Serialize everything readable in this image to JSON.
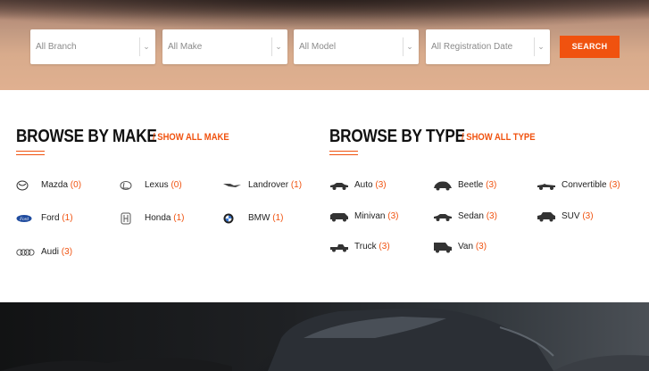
{
  "search": {
    "branch": "All Branch",
    "make": "All Make",
    "model": "All Model",
    "registration_date": "All Registration Date",
    "button": "SEARCH"
  },
  "make_section": {
    "title": "BROWSE BY MAKE",
    "show_all": "/ SHOW ALL MAKE",
    "items": [
      {
        "name": "Mazda",
        "count": "(0)",
        "icon": "mazda-logo-icon"
      },
      {
        "name": "Lexus",
        "count": "(0)",
        "icon": "lexus-logo-icon"
      },
      {
        "name": "Landrover",
        "count": "(1)",
        "icon": "landrover-logo-icon"
      },
      {
        "name": "Ford",
        "count": "(1)",
        "icon": "ford-logo-icon"
      },
      {
        "name": "Honda",
        "count": "(1)",
        "icon": "honda-logo-icon"
      },
      {
        "name": "BMW",
        "count": "(1)",
        "icon": "bmw-logo-icon"
      },
      {
        "name": "Audi",
        "count": "(3)",
        "icon": "audi-logo-icon"
      }
    ]
  },
  "type_section": {
    "title": "BROWSE BY TYPE",
    "show_all": "/ SHOW ALL TYPE",
    "items": [
      {
        "name": "Auto",
        "count": "(3)",
        "icon": "auto-car-icon"
      },
      {
        "name": "Beetle",
        "count": "(3)",
        "icon": "beetle-car-icon"
      },
      {
        "name": "Convertible",
        "count": "(3)",
        "icon": "convertible-car-icon"
      },
      {
        "name": "Minivan",
        "count": "(3)",
        "icon": "minivan-icon"
      },
      {
        "name": "Sedan",
        "count": "(3)",
        "icon": "sedan-car-icon"
      },
      {
        "name": "SUV",
        "count": "(3)",
        "icon": "suv-car-icon"
      },
      {
        "name": "Truck",
        "count": "(3)",
        "icon": "truck-icon"
      },
      {
        "name": "Van",
        "count": "(3)",
        "icon": "van-icon"
      }
    ]
  },
  "colors": {
    "accent": "#f0520f",
    "text": "#111111"
  }
}
